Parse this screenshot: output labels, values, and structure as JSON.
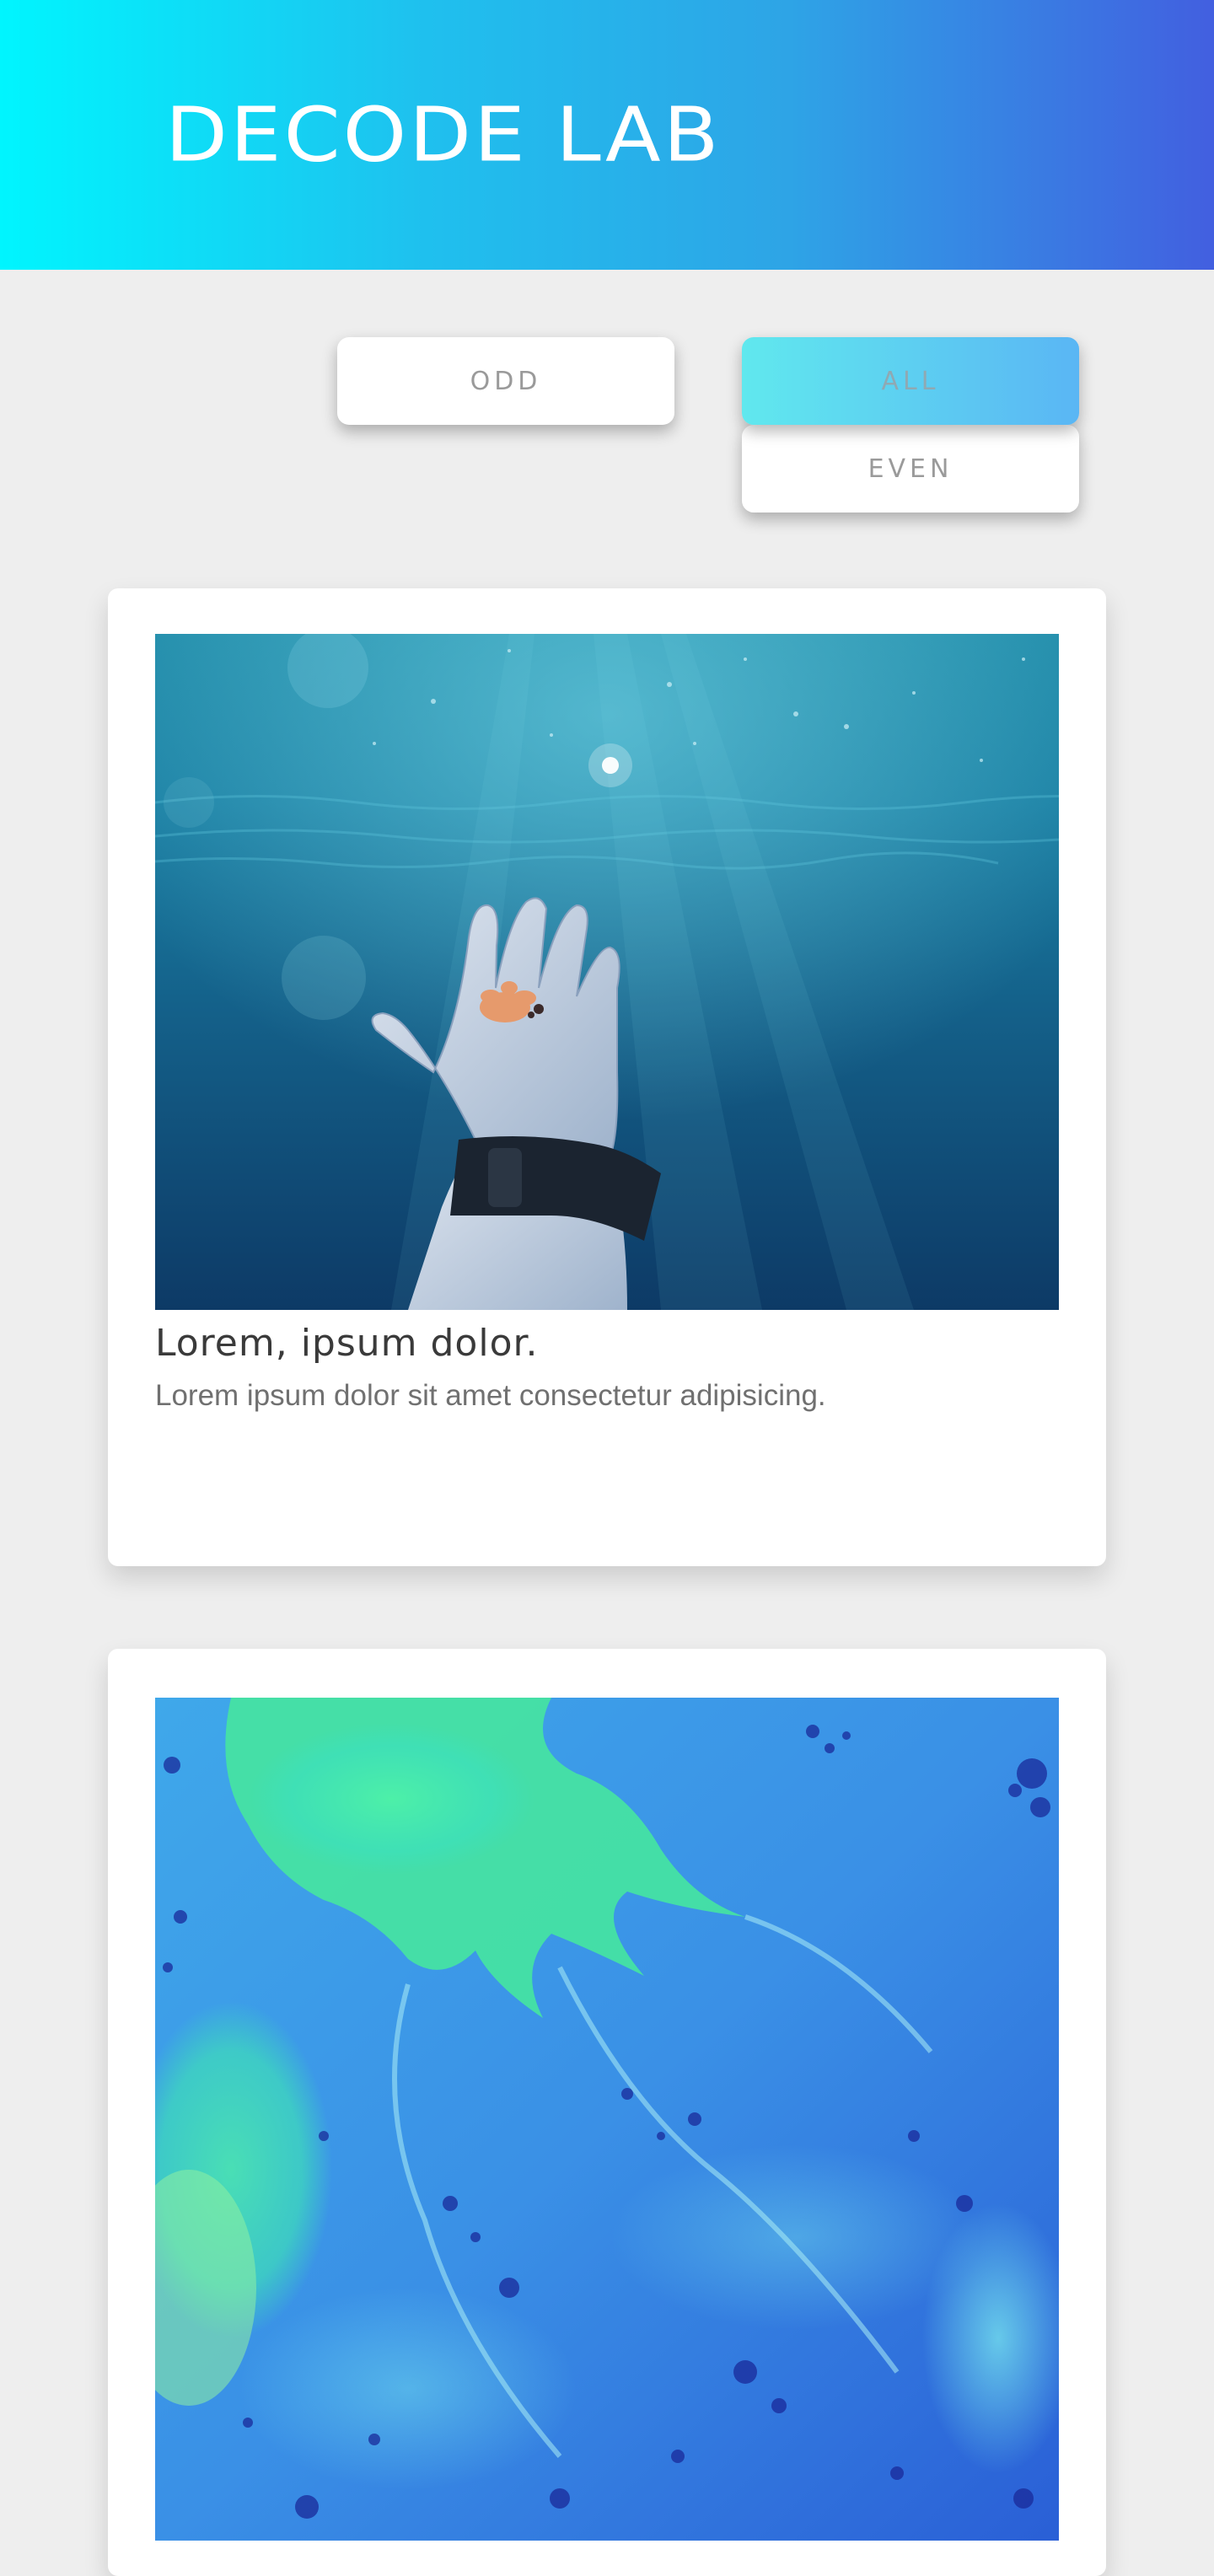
{
  "header": {
    "brand": "DECODE LAB",
    "gradient": [
      "#00f5fe",
      "#1fc0ee",
      "#2ea4e6",
      "#425fe0"
    ]
  },
  "filters": {
    "odd_label": "ODD",
    "all_label": "ALL",
    "even_label": "EVEN",
    "active": "ALL"
  },
  "cards": [
    {
      "title": "Lorem, ipsum dolor.",
      "description": "Lorem ipsum dolor sit amet consectetur adipisicing.",
      "image": "underwater-hand-photo"
    },
    {
      "image": "blue-green-marble-photo"
    }
  ]
}
